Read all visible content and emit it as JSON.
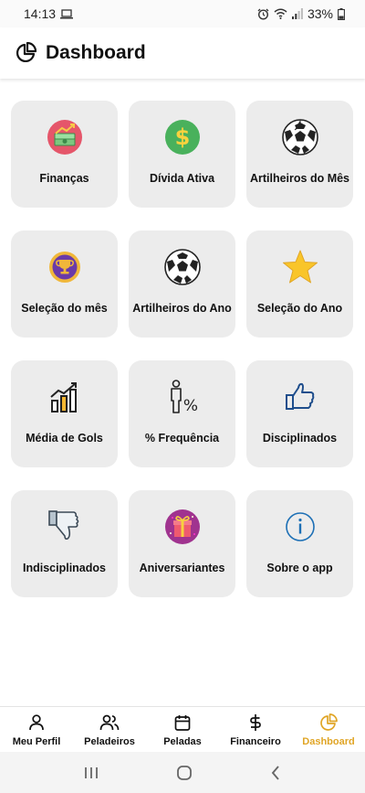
{
  "status_bar": {
    "time": "14:13",
    "battery": "33%",
    "icons": [
      "laptop-icon",
      "alarm-icon",
      "wifi-icon",
      "signal-icon",
      "battery-icon"
    ]
  },
  "header": {
    "title": "Dashboard",
    "icon": "pie-chart-icon"
  },
  "cards": [
    {
      "label": "Finanças",
      "icon": "money-icon"
    },
    {
      "label": "Dívida Ativa",
      "icon": "dollar-icon"
    },
    {
      "label": "Artilheiros do Mês",
      "icon": "soccer-ball-icon"
    },
    {
      "label": "Seleção do mês",
      "icon": "trophy-icon"
    },
    {
      "label": "Artilheiros do Ano",
      "icon": "soccer-ball-icon"
    },
    {
      "label": "Seleção do Ano",
      "icon": "star-icon"
    },
    {
      "label": "Média de Gols",
      "icon": "bar-chart-icon"
    },
    {
      "label": "% Frequência",
      "icon": "person-percent-icon"
    },
    {
      "label": "Disciplinados",
      "icon": "thumbs-up-icon"
    },
    {
      "label": "Indisciplinados",
      "icon": "thumbs-down-icon"
    },
    {
      "label": "Aniversariantes",
      "icon": "gift-icon"
    },
    {
      "label": "Sobre o app",
      "icon": "info-icon"
    }
  ],
  "bottom_nav": [
    {
      "label": "Meu Perfil",
      "icon": "user-icon"
    },
    {
      "label": "Peladeiros",
      "icon": "users-icon"
    },
    {
      "label": "Peladas",
      "icon": "calendar-icon"
    },
    {
      "label": "Financeiro",
      "icon": "dollar-sign-icon"
    },
    {
      "label": "Dashboard",
      "icon": "pie-chart-icon",
      "active": true
    }
  ],
  "colors": {
    "accent": "#e0a526",
    "card_bg": "#ececec",
    "text": "#111111"
  }
}
